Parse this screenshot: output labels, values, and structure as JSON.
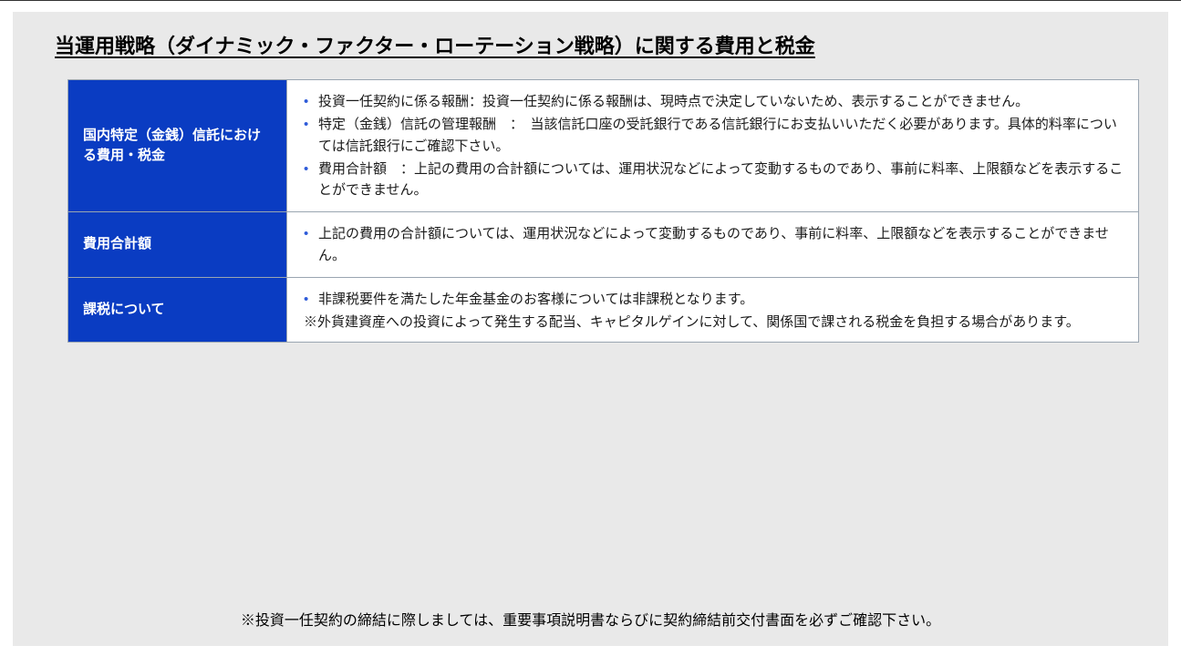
{
  "title": "当運用戦略（ダイナミック・ファクター・ローテーション戦略）に関する費用と税金",
  "rows": [
    {
      "header": "国内特定（金銭）信託における費用・税金",
      "bullets": [
        "投資一任契約に係る報酬：投資一任契約に係る報酬は、現時点で決定していないため、表示することができません。",
        "特定（金銭）信託の管理報酬　：　当該信託口座の受託銀行である信託銀行にお支払いいただく必要があります。具体的料率については信託銀行にご確認下さい。",
        "費用合計額　：上記の費用の合計額については、運用状況などによって変動するものであり、事前に料率、上限額などを表示することができません。"
      ],
      "note": ""
    },
    {
      "header": "費用合計額",
      "bullets": [
        "上記の費用の合計額については、運用状況などによって変動するものであり、事前に料率、上限額などを表示することができません。"
      ],
      "note": ""
    },
    {
      "header": "課税について",
      "bullets": [
        "非課税要件を満たした年金基金のお客様については非課税となります。"
      ],
      "note": "※外貨建資産への投資によって発生する配当、キャピタルゲインに対して、関係国で課される税金を負担する場合があります。"
    }
  ],
  "footer_note": "※投資一任契約の締結に際しましては、重要事項説明書ならびに契約締結前交付書面を必ずご確認下さい。"
}
